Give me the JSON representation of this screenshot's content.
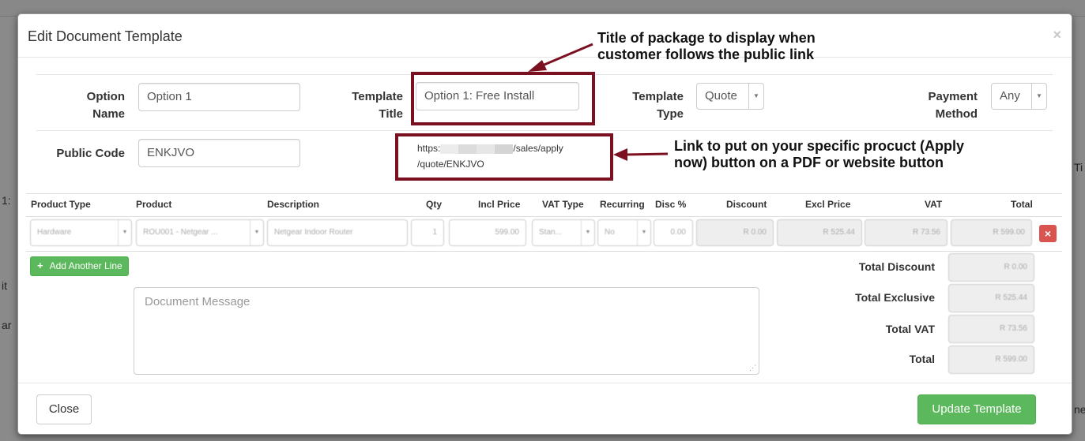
{
  "background": {
    "fragments": [
      "1:",
      "it",
      "ar",
      "Ti",
      "ne"
    ]
  },
  "modal": {
    "title": "Edit Document Template",
    "close_glyph": "×"
  },
  "form": {
    "option_name_label_line1": "Option",
    "option_name_label_line2": "Name",
    "option_name_value": "Option 1",
    "template_title_label_line1": "Template",
    "template_title_label_line2": "Title",
    "template_title_value": "Option 1: Free Install",
    "template_type_label_line1": "Template",
    "template_type_label_line2": "Type",
    "template_type_value": "Quote",
    "payment_method_label_line1": "Payment",
    "payment_method_label_line2": "Method",
    "payment_method_value": "Any",
    "public_code_label": "Public Code",
    "public_code_value": "ENKJVO",
    "public_link_prefix": "https:",
    "public_link_suffix": "/sales/apply",
    "public_link_line2": "/quote/ENKJVO"
  },
  "annotations": {
    "title_note_line1": "Title of package to display when",
    "title_note_line2": "customer follows the public link",
    "link_note_line1": "Link to put on your specific procuct (Apply",
    "link_note_line2": "now) button on a PDF or website button",
    "accent_color": "#7b1020"
  },
  "table": {
    "headers": [
      "Product Type",
      "Product",
      "Description",
      "Qty",
      "Incl Price",
      "VAT Type",
      "Recurring",
      "Disc %",
      "Discount",
      "Excl Price",
      "VAT",
      "Total"
    ],
    "row": {
      "product_type": "Hardware",
      "product": "ROU001 - Netgear ...",
      "description": "Netgear Indoor Router",
      "qty": "1",
      "incl_price": "599.00",
      "vat_type": "Stan...",
      "recurring": "No",
      "disc_pct": "0.00",
      "discount": "R 0.00",
      "excl_price": "R 525.44",
      "vat": "R 73.56",
      "total": "R 599.00"
    },
    "delete_glyph": "×",
    "add_line_label": "Add Another Line",
    "add_line_glyph": "+"
  },
  "message": {
    "placeholder": "Document Message"
  },
  "totals": {
    "total_discount_label": "Total Discount",
    "total_discount_value": "R 0.00",
    "total_exclusive_label": "Total Exclusive",
    "total_exclusive_value": "R 525.44",
    "total_vat_label": "Total VAT",
    "total_vat_value": "R 73.56",
    "total_label": "Total",
    "total_value": "R 599.00"
  },
  "footer": {
    "close_label": "Close",
    "update_label": "Update Template"
  }
}
